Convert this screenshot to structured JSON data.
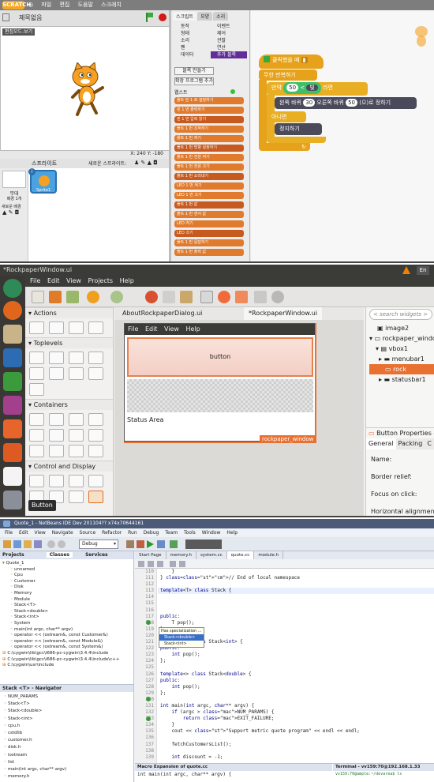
{
  "scratch": {
    "logo": "SCRATCH",
    "menu": [
      "파일",
      "편집",
      "도움말",
      "스크래치"
    ],
    "project_title": "제목없음",
    "version": "v434",
    "stage_mode": "편집모드:보기",
    "coords": "X: 240  Y: -180",
    "sprites_header": "스프라이트",
    "new_sprite_label": "새로운 스프라이트:",
    "stage_label": "무대",
    "stage_sub": "배경 1개",
    "new_bg_label": "새로운 배경",
    "sprite_name": "Sprite1",
    "tabs": [
      "스크립트",
      "모양",
      "소리"
    ],
    "categories_left": [
      "동작",
      "형태",
      "소리",
      "펜",
      "데이터"
    ],
    "categories_right": [
      "이벤트",
      "제어",
      "관찰",
      "연산",
      "추가 블록"
    ],
    "cat_colors_left": [
      "#4a6cd4",
      "#8a55d7",
      "#bb42c3",
      "#0e9a6c",
      "#ee7d16"
    ],
    "cat_colors_right": [
      "#c88330",
      "#e1a91a",
      "#2ca5e2",
      "#5cb712",
      "#632d99"
    ],
    "make_block": "블록 만들기",
    "add_extension": "확장 프로그램 추가",
    "extension_name": "웹스트",
    "palette_blocks": [
      "폴트 번 1 로 설정하기",
      "핀 1 번 출력하기",
      "핀 1 번 입력 읽기",
      "폴트 1 번 조작하기",
      "폴트 1 번 켜기",
      "폴트 1 번 방향 설정하기",
      "폴트 1 번 전원 켜기",
      "폴트 1 번 전원 끄기",
      "폴트 1 번 소리내기",
      "LED 1 번 켜기",
      "LED 1 번 끄기",
      "폴트 1 번 값",
      "폴트 1 번 센서 값",
      "LED 켜기",
      "LED 끄기",
      "폴트 1 번 응답하기",
      "폴트 1 번 출력 값"
    ],
    "script": {
      "hat": "클릭했을 때",
      "forever": "무한 반복하기",
      "if_label": "만약",
      "if_value": "50",
      "if_op": "<",
      "if_sensor": "빛",
      "if_then": "라면",
      "motor_pre": "왼쪽 바퀴",
      "motor_l": "30",
      "motor_mid": "오른쪽 바퀴",
      "motor_r": "50",
      "motor_post": "(으)로 정하기",
      "else_label": "아니면",
      "stop_label": "정지하기"
    }
  },
  "glade": {
    "title": "*RockpaperWindow.ui",
    "menu": [
      "File",
      "Edit",
      "View",
      "Projects",
      "Help"
    ],
    "lang": "En",
    "groups": [
      "Actions",
      "Toplevels",
      "Containers",
      "Control and Display"
    ],
    "tooltip": "Button",
    "tabs": [
      "AboutRockpaperDialog.ui",
      "*RockpaperWindow.ui"
    ],
    "preview_menu": [
      "File",
      "Edit",
      "View",
      "Help"
    ],
    "preview_button": "button",
    "status_area": "Status Area",
    "window_label": "rockpaper_window",
    "search_placeholder": "search widgets",
    "tree": [
      "image2",
      "rockpaper_window",
      "vbox1",
      "menubar1",
      "rock",
      "statusbar1"
    ],
    "props_title": "Button Properties - C",
    "props_tabs": [
      "General",
      "Packing",
      "C"
    ],
    "props": [
      "Name:",
      "Border relief:",
      "Focus on click:",
      "Horizontal alignment:"
    ]
  },
  "netbeans": {
    "title": "Quote_1 - NetBeans IDE Dev 201104?? x74x70644161",
    "menu": [
      "File",
      "Edit",
      "View",
      "Navigate",
      "Source",
      "Refactor",
      "Run",
      "Debug",
      "Team",
      "Tools",
      "Window",
      "Help"
    ],
    "config": "Debug",
    "panel_tabs": [
      "Projects",
      "Classes",
      "Services"
    ],
    "project_tree": [
      "Quote_1",
      "unnamed",
      "Cpu",
      "Customer",
      "Disk",
      "Memory",
      "Module",
      "Stack<T>",
      "Stack<double>",
      "Stack<int>",
      "System",
      "main(int argc, char** argv)",
      "operator << (ostream&, const Customer&)",
      "operator << (ostream&, const Module&)",
      "operator << (ostream&, const System&)",
      "C:\\cygwin\\lib\\gcc\\i686-pc-cygwin\\3.4.4\\include",
      "C:\\cygwin\\lib\\gcc\\i686-pc-cygwin\\3.4.4\\include\\c++",
      "C:\\cygwin\\usr\\include"
    ],
    "navigator_title": "Stack <T> - Navigator",
    "navigator_tree": [
      "NUM_PARAMS",
      "Stack<T>",
      "Stack<double>",
      "Stack<int>",
      "cpu.h",
      "cstdlib",
      "customer.h",
      "disk.h",
      "iostream",
      "list",
      "main(int argc, char** argv)",
      "memory.h"
    ],
    "editor_tabs": [
      "Start Page",
      "memory.h",
      "system.cc",
      "quote.cc",
      "module.h"
    ],
    "line_numbers": [
      "110",
      "111",
      "112",
      "113",
      "114",
      "115",
      "116",
      "117",
      "118",
      "119",
      "120",
      "121",
      "122",
      "123",
      "124",
      "125",
      "126",
      "127",
      "128",
      "129",
      "130",
      "131",
      "132",
      "133",
      "134",
      "135",
      "136",
      "137",
      "138",
      "139"
    ],
    "code": [
      "    }",
      "} // End of local namespace",
      "",
      "template<T> class Stack {",
      "",
      "",
      "",
      "public:",
      "    T pop();",
      "};",
      "",
      "template<> class Stack<int> {",
      "public:",
      "    int pop();",
      "};",
      "",
      "template<> class Stack<double> {",
      "public:",
      "    int pop();",
      "};",
      "",
      "int main(int argc, char** argv) {",
      "    if (argc > NUM_PARAMS) {",
      "        return EXIT_FAILURE;",
      "    }",
      "    cout << \"Support metric quote program\" << endl << endl;",
      "",
      "    fetchCustomersList();",
      "",
      "    int discount = -1;"
    ],
    "popup_title": "Has specialization ...",
    "popup_items": [
      "Stack<double>",
      "Stack<int>"
    ],
    "macro_title": "Macro Expansion of quote.cc",
    "macro_code": "int main(int argc, char** argv) {",
    "terminal_title": "Terminal - vv159:70@192.168.1.33",
    "terminal_line": "vv159:70@ample:~/devarea$ ls"
  }
}
